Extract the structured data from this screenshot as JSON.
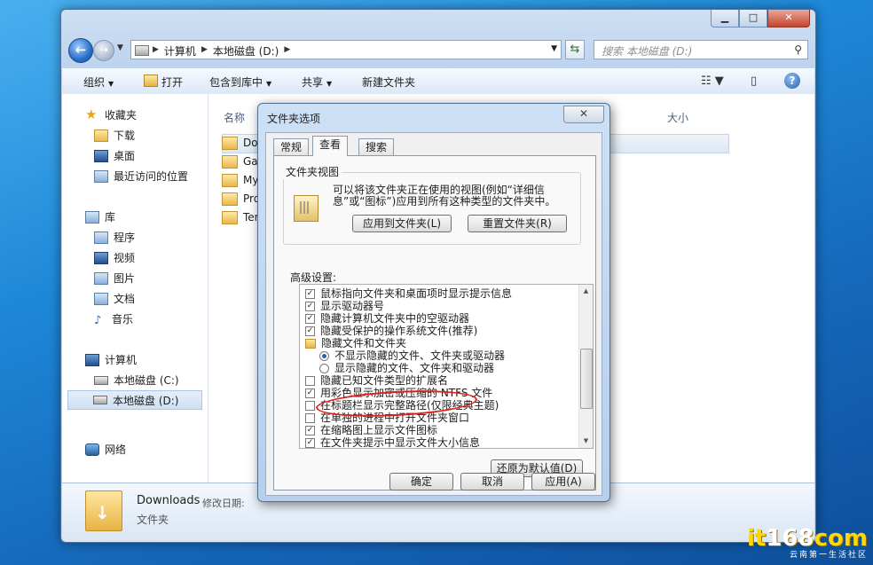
{
  "window": {
    "caption": {
      "minimize": "▁",
      "maximize": "□",
      "close": "✕"
    }
  },
  "nav": {
    "back": "←",
    "forward": "→",
    "crumbs": [
      "计算机",
      "本地磁盘 (D:)"
    ],
    "search_placeholder": "搜索 本地磁盘 (D:)"
  },
  "toolbar": {
    "organize": "组织",
    "open": "打开",
    "include_library": "包含到库中",
    "share": "共享",
    "new_folder": "新建文件夹"
  },
  "sidebar": {
    "favorites": "收藏夹",
    "downloads": "下载",
    "desktop": "桌面",
    "recent": "最近访问的位置",
    "libraries": "库",
    "programs": "程序",
    "videos": "视频",
    "pictures": "图片",
    "documents": "文档",
    "music": "音乐",
    "computer": "计算机",
    "drive_c": "本地磁盘 (C:)",
    "drive_d": "本地磁盘 (D:)",
    "network": "网络"
  },
  "list": {
    "columns": {
      "name": "名称",
      "size": "大小"
    },
    "files": [
      "Dov",
      "Gar",
      "My",
      "Pro",
      "Ter"
    ]
  },
  "details": {
    "name": "Downloads",
    "modified_label": "修改日期:",
    "type": "文件夹"
  },
  "dialog": {
    "title": "文件夹选项",
    "close": "✕",
    "tabs": [
      "常规",
      "查看",
      "搜索"
    ],
    "folder_views_label": "文件夹视图",
    "folder_views_text": "可以将该文件夹正在使用的视图(例如“详细信息”或“图标”)应用到所有这种类型的文件夹中。",
    "apply_to_folders": "应用到文件夹(L)",
    "reset_folders": "重置文件夹(R)",
    "advanced_label": "高级设置:",
    "options": [
      {
        "label": "鼠标指向文件夹和桌面项时显示提示信息",
        "checked": true
      },
      {
        "label": "显示驱动器号",
        "checked": true
      },
      {
        "label": "隐藏计算机文件夹中的空驱动器",
        "checked": true
      },
      {
        "label": "隐藏受保护的操作系统文件(推荐)",
        "checked": true
      },
      {
        "label": "隐藏文件和文件夹",
        "type": "folder"
      },
      {
        "label": "不显示隐藏的文件、文件夹或驱动器",
        "type": "radio",
        "checked": true
      },
      {
        "label": "显示隐藏的文件、文件夹和驱动器",
        "type": "radio",
        "checked": false
      },
      {
        "label": "隐藏已知文件类型的扩展名",
        "checked": false
      },
      {
        "label": "用彩色显示加密或压缩的 NTFS 文件",
        "checked": true
      },
      {
        "label": "在标题栏显示完整路径(仅限经典主题)",
        "checked": false
      },
      {
        "label": "在单独的进程中打开文件夹窗口",
        "checked": false
      },
      {
        "label": "在缩略图上显示文件图标",
        "checked": true
      },
      {
        "label": "在文件夹提示中显示文件大小信息",
        "checked": true
      }
    ],
    "restore_defaults": "还原为默认值(D)",
    "ok": "确定",
    "cancel": "取消",
    "apply": "应用(A)"
  },
  "watermark": {
    "logo_a": "it",
    "logo_b": "168",
    "logo_c": "com",
    "sub": "云南第一生活社区"
  }
}
